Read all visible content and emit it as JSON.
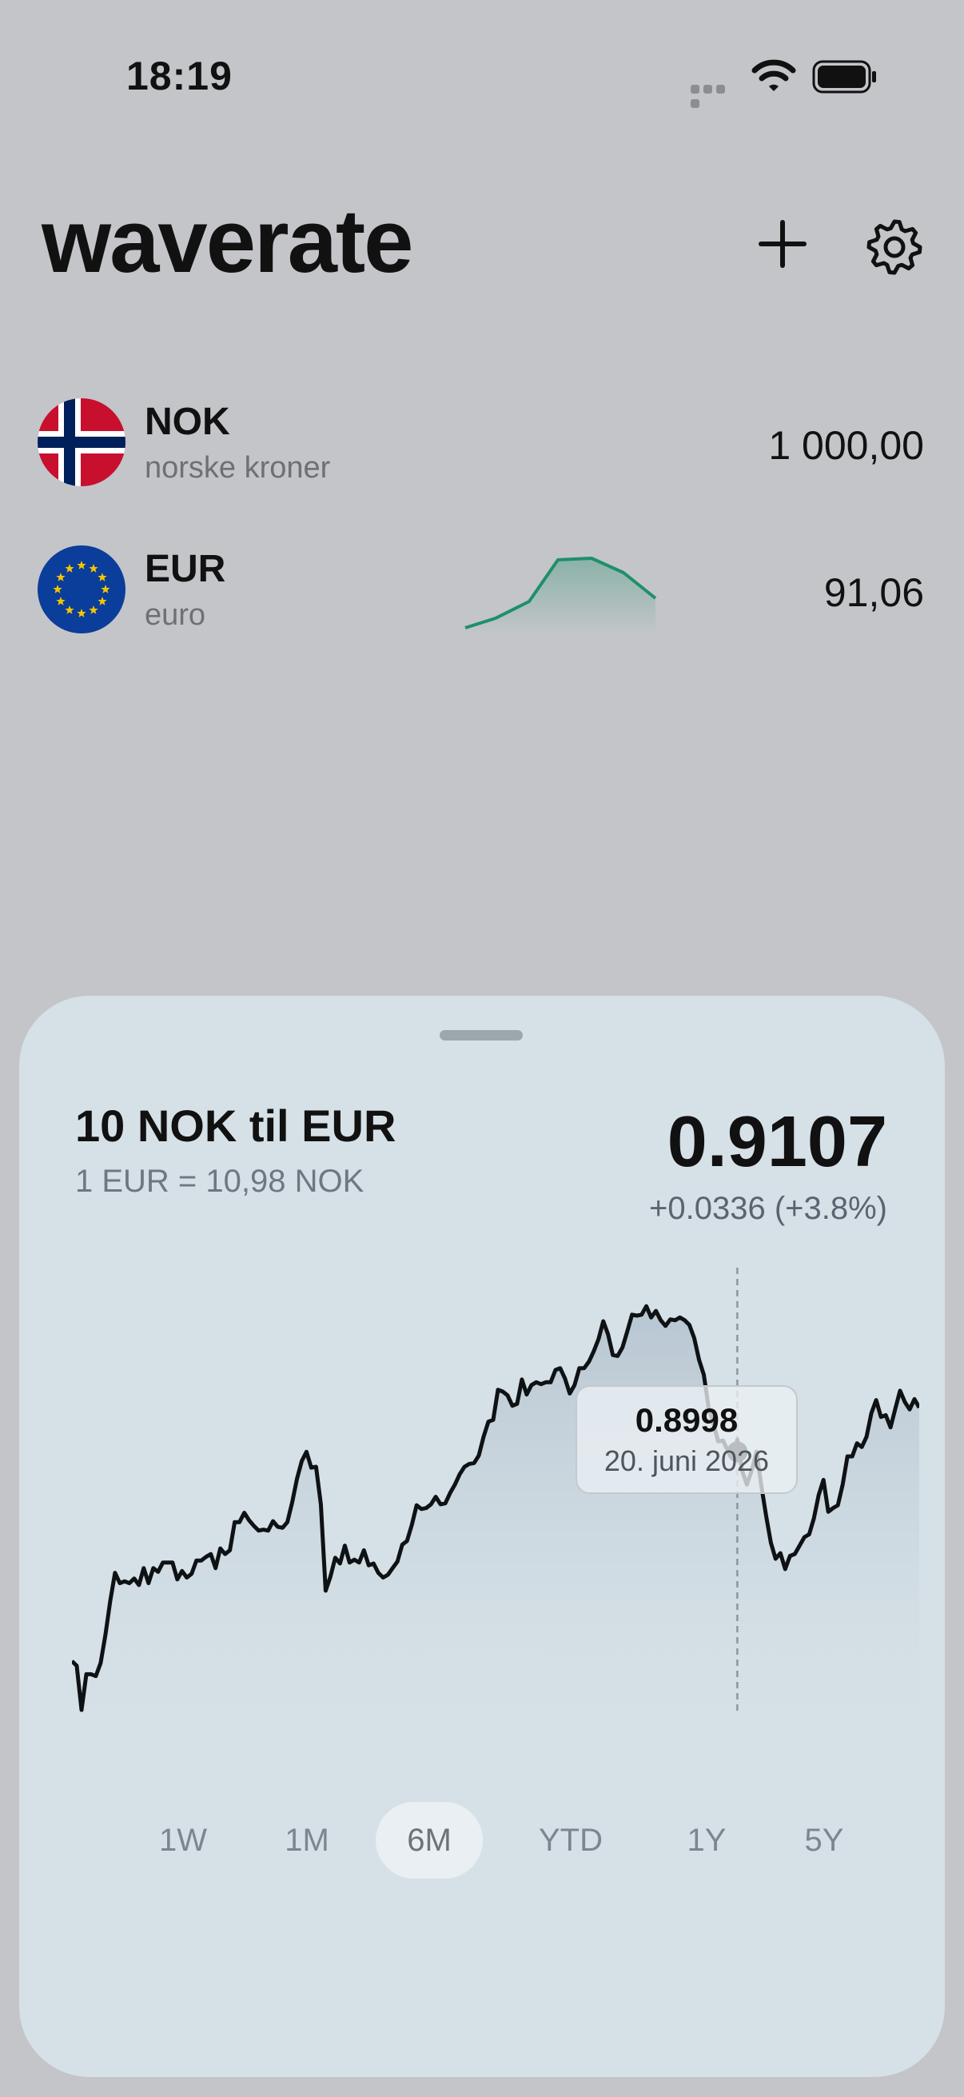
{
  "status_bar": {
    "time": "18:19"
  },
  "header": {
    "title": "waverate",
    "add_icon": "plus-icon",
    "settings_icon": "gear-icon"
  },
  "currencies": [
    {
      "code": "NOK",
      "name": "norske kroner",
      "amount": "1 000,00",
      "flag": "norway-flag"
    },
    {
      "code": "EUR",
      "name": "euro",
      "amount": "91,06",
      "flag": "eu-flag",
      "trend_color": "#1f8f6a"
    }
  ],
  "sheet": {
    "title": "10 NOK til EUR",
    "subtitle": "1 EUR = 10,98 NOK",
    "value": "0.9107",
    "change": "+0.0336 (+3.8%)",
    "tooltip": {
      "value": "0.8998",
      "date": "20. juni 2026"
    },
    "ranges": [
      "1W",
      "1M",
      "6M",
      "YTD",
      "1Y",
      "5Y"
    ],
    "active_range": "6M"
  },
  "chart_data": {
    "type": "line",
    "series": [
      {
        "values": [
          0.8775,
          0.877,
          0.8723,
          0.8761,
          0.8761,
          0.8759,
          0.8773,
          0.8803,
          0.8839,
          0.8869,
          0.8858,
          0.886,
          0.8858,
          0.8863,
          0.8856,
          0.8874,
          0.8858,
          0.8874,
          0.887,
          0.888,
          0.888,
          0.888,
          0.8862,
          0.8871,
          0.8864,
          0.8868,
          0.8882,
          0.8882,
          0.8886,
          0.8889,
          0.8874,
          0.8895,
          0.8889,
          0.8893,
          0.8923,
          0.8923,
          0.8933,
          0.8925,
          0.8919,
          0.8914,
          0.8915,
          0.8914,
          0.8924,
          0.8918,
          0.8917,
          0.8923,
          0.8944,
          0.8969,
          0.8988,
          0.8998,
          0.8981,
          0.8982,
          0.8942,
          0.885,
          0.8865,
          0.8885,
          0.8879,
          0.8898,
          0.888,
          0.8883,
          0.888,
          0.8893,
          0.8877,
          0.8879,
          0.8869,
          0.8864,
          0.8867,
          0.8874,
          0.8881,
          0.8899,
          0.8903,
          0.892,
          0.8941,
          0.8937,
          0.8938,
          0.8942,
          0.895,
          0.8942,
          0.8943,
          0.8954,
          0.8963,
          0.8974,
          0.8982,
          0.8985,
          0.8986,
          0.8994,
          0.9014,
          0.903,
          0.9032,
          0.9064,
          0.9062,
          0.9058,
          0.9047,
          0.9049,
          0.9075,
          0.9059,
          0.9069,
          0.9072,
          0.907,
          0.9072,
          0.9072,
          0.9085,
          0.9087,
          0.9076,
          0.906,
          0.9069,
          0.9087,
          0.9087,
          0.9094,
          0.9105,
          0.9118,
          0.9137,
          0.9123,
          0.9101,
          0.91,
          0.9109,
          0.9126,
          0.9144,
          0.9143,
          0.9144,
          0.9153,
          0.9141,
          0.9148,
          0.9138,
          0.9132,
          0.9139,
          0.9138,
          0.9141,
          0.9138,
          0.9133,
          0.9119,
          0.9096,
          0.908,
          0.9045,
          0.9028,
          0.9009,
          0.901,
          0.8999,
          0.8991,
          0.9011,
          0.8978,
          0.8963,
          0.8978,
          0.8998,
          0.8962,
          0.893,
          0.8901,
          0.8884,
          0.889,
          0.8873,
          0.8887,
          0.8889,
          0.8898,
          0.8907,
          0.891,
          0.8927,
          0.8952,
          0.8968,
          0.8934,
          0.8938,
          0.8941,
          0.8963,
          0.8993,
          0.8993,
          0.9007,
          0.9003,
          0.9014,
          0.9039,
          0.9053,
          0.9035,
          0.9037,
          0.9024,
          0.9044,
          0.9063,
          0.9051,
          0.9043,
          0.9054,
          0.9045
        ]
      }
    ],
    "xlabel": "",
    "ylabel": "",
    "ylim": [
      0.87,
      0.916
    ],
    "highlight": {
      "index": 139,
      "value": 0.8998,
      "date": "20. juni 2026"
    },
    "line_color": "#0f1214",
    "fill_color": "#b9c6d1"
  }
}
